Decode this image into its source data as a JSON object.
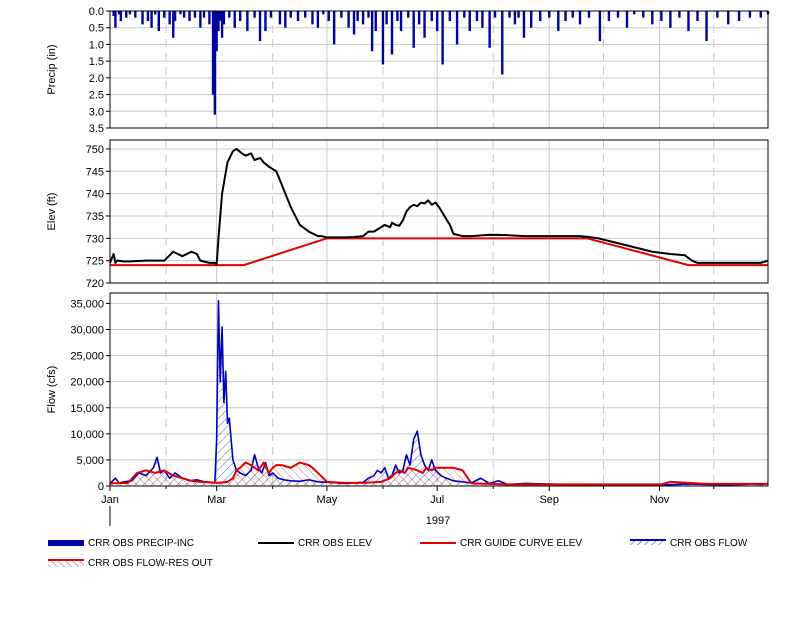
{
  "chart_data": [
    {
      "type": "bar",
      "panel": "precip",
      "ylabel": "Precip (in)",
      "ylim": [
        3.5,
        0.0
      ],
      "inverted": true,
      "yticks": [
        0.0,
        0.5,
        1.0,
        1.5,
        2.0,
        2.5,
        3.0,
        3.5
      ],
      "ytick_labels": [
        "0.0",
        "0.5",
        "1.0",
        "1.5",
        "2.0",
        "2.5",
        "3.0",
        "3.5"
      ],
      "grid": true,
      "series": [
        {
          "name": "CRR OBS PRECIP-INC",
          "color": "#0000a0",
          "x_day": [
            2,
            3,
            5,
            6,
            9,
            11,
            14,
            18,
            21,
            23,
            25,
            27,
            30,
            33,
            35,
            36,
            39,
            41,
            44,
            47,
            50,
            52,
            55,
            57,
            58,
            59,
            60,
            61,
            62,
            63,
            66,
            69,
            72,
            76,
            80,
            83,
            86,
            89,
            94,
            97,
            100,
            104,
            108,
            112,
            115,
            118,
            121,
            124,
            128,
            132,
            135,
            137,
            140,
            143,
            145,
            147,
            151,
            153,
            156,
            159,
            161,
            165,
            168,
            171,
            174,
            178,
            181,
            184,
            188,
            192,
            196,
            199,
            203,
            206,
            210,
            213,
            217,
            221,
            224,
            226,
            229,
            233,
            238,
            243,
            248,
            252,
            256,
            260,
            265,
            271,
            276,
            281,
            286,
            290,
            295,
            300,
            305,
            310,
            315,
            320,
            325,
            330,
            336,
            342,
            348,
            354,
            360,
            364
          ],
          "values": [
            0.15,
            0.5,
            0.1,
            0.3,
            0.2,
            0.1,
            0.2,
            0.4,
            0.3,
            0.5,
            0.1,
            0.6,
            0.2,
            0.4,
            0.8,
            0.3,
            0.1,
            0.2,
            0.3,
            0.2,
            0.5,
            0.2,
            0.4,
            2.5,
            3.1,
            1.2,
            0.6,
            0.3,
            0.8,
            0.4,
            0.2,
            0.5,
            0.3,
            0.6,
            0.2,
            0.9,
            0.6,
            0.2,
            0.4,
            0.5,
            0.2,
            0.3,
            0.2,
            0.4,
            0.5,
            0.1,
            0.3,
            1.0,
            0.2,
            0.5,
            0.7,
            0.3,
            0.4,
            0.2,
            1.2,
            0.6,
            1.6,
            0.4,
            1.3,
            0.3,
            0.6,
            0.2,
            1.1,
            0.4,
            0.8,
            0.3,
            0.6,
            1.6,
            0.3,
            1.0,
            0.2,
            0.6,
            0.3,
            0.5,
            1.1,
            0.2,
            1.9,
            0.2,
            0.4,
            0.2,
            0.8,
            0.5,
            0.3,
            0.2,
            0.6,
            0.3,
            0.2,
            0.4,
            0.2,
            0.9,
            0.3,
            0.2,
            0.5,
            0.1,
            0.2,
            0.4,
            0.3,
            0.5,
            0.2,
            0.6,
            0.3,
            0.9,
            0.2,
            0.4,
            0.3,
            0.2,
            0.2,
            0.1
          ]
        }
      ]
    },
    {
      "type": "line",
      "panel": "elev",
      "ylabel": "Elev (ft)",
      "ylim": [
        720,
        752
      ],
      "yticks": [
        720,
        725,
        730,
        735,
        740,
        745,
        750
      ],
      "ytick_labels": [
        "720",
        "725",
        "730",
        "735",
        "740",
        "745",
        "750"
      ],
      "grid": true,
      "series": [
        {
          "name": "CRR OBS ELEV",
          "color": "#000000",
          "x_day": [
            0,
            2,
            3,
            4,
            8,
            20,
            30,
            35,
            40,
            45,
            48,
            50,
            55,
            58,
            59,
            60,
            62,
            65,
            68,
            70,
            73,
            75,
            78,
            80,
            83,
            85,
            88,
            92,
            96,
            100,
            105,
            110,
            115,
            117,
            120,
            125,
            130,
            135,
            140,
            143,
            146,
            148,
            152,
            155,
            156,
            158,
            160,
            162,
            164,
            166,
            168,
            170,
            172,
            174,
            176,
            178,
            180,
            182,
            185,
            188,
            190,
            195,
            200,
            210,
            220,
            230,
            240,
            250,
            260,
            265,
            270,
            280,
            290,
            300,
            310,
            318,
            322,
            325,
            330,
            340,
            350,
            360,
            364
          ],
          "values": [
            724.5,
            726.5,
            724.5,
            725,
            724.8,
            725,
            725,
            727,
            726,
            727,
            726.5,
            725,
            724.5,
            724.5,
            724.2,
            730,
            740,
            747,
            749.5,
            750,
            749,
            748.5,
            749,
            747.5,
            748,
            747,
            746,
            745,
            741,
            737,
            733,
            731.5,
            730.5,
            730.5,
            730.2,
            730.2,
            730.2,
            730.3,
            730.5,
            731.5,
            731.5,
            732,
            733,
            732.5,
            733.5,
            733,
            732.8,
            734,
            736,
            737,
            737.5,
            737.2,
            738,
            737.8,
            738.5,
            737.5,
            738,
            737,
            735,
            733,
            731,
            730.5,
            730.5,
            730.8,
            730.7,
            730.5,
            730.5,
            730.5,
            730.5,
            730.3,
            730,
            729,
            728,
            727,
            726.5,
            726.2,
            725,
            724.5,
            724.5,
            724.5,
            724.5,
            724.5,
            725
          ]
        },
        {
          "name": "CRR GUIDE CURVE ELEV",
          "color": "#e00000",
          "x_day": [
            0,
            74,
            120,
            264,
            320,
            364
          ],
          "values": [
            724,
            724,
            730,
            730,
            724,
            724
          ]
        }
      ]
    },
    {
      "type": "area",
      "panel": "flow",
      "ylabel": "Flow (cfs)",
      "xlabel": "1997",
      "ylim": [
        0,
        37000
      ],
      "yticks": [
        0,
        5000,
        10000,
        15000,
        20000,
        25000,
        30000,
        35000
      ],
      "ytick_labels": [
        "0",
        "5,000",
        "10,000",
        "15,000",
        "20,000",
        "25,000",
        "30,000",
        "35,000"
      ],
      "x_tick_labels": [
        "Jan",
        "Mar",
        "May",
        "Jul",
        "Sep",
        "Nov"
      ],
      "x_tick_days": [
        0,
        59,
        120,
        181,
        243,
        304
      ],
      "grid": true,
      "series": [
        {
          "name": "CRR OBS FLOW",
          "color": "#0000c0",
          "x_day": [
            0,
            3,
            5,
            8,
            12,
            16,
            20,
            24,
            26,
            28,
            30,
            33,
            36,
            40,
            44,
            48,
            52,
            56,
            58,
            59,
            60,
            61,
            62,
            63,
            64,
            65,
            66,
            67,
            68,
            70,
            72,
            75,
            78,
            80,
            82,
            84,
            86,
            88,
            90,
            93,
            96,
            100,
            105,
            110,
            115,
            120,
            125,
            130,
            135,
            140,
            143,
            146,
            148,
            150,
            152,
            154,
            156,
            158,
            160,
            162,
            164,
            166,
            168,
            170,
            172,
            174,
            176,
            178,
            180,
            183,
            186,
            190,
            195,
            200,
            205,
            210,
            215,
            220,
            230,
            240,
            250,
            260,
            270,
            280,
            290,
            300,
            310,
            320,
            330,
            340,
            350,
            355,
            360,
            364
          ],
          "values": [
            500,
            1500,
            600,
            800,
            1000,
            2500,
            2000,
            3500,
            5500,
            2500,
            3000,
            1500,
            2500,
            1500,
            1000,
            1200,
            800,
            700,
            600,
            9000,
            35500,
            20000,
            30500,
            16000,
            22000,
            12000,
            13000,
            9000,
            5000,
            3000,
            2500,
            2000,
            3000,
            6000,
            3500,
            2500,
            4500,
            2000,
            2500,
            1500,
            1200,
            1000,
            900,
            1200,
            800,
            700,
            600,
            500,
            600,
            700,
            1500,
            2000,
            3000,
            2500,
            3500,
            1500,
            2000,
            4000,
            2500,
            3000,
            6000,
            4000,
            9000,
            10500,
            6000,
            4000,
            3000,
            5000,
            3000,
            2000,
            1500,
            1000,
            800,
            600,
            1500,
            500,
            1000,
            300,
            500,
            400,
            300,
            300,
            250,
            300,
            250,
            300,
            250,
            400,
            300,
            250,
            300,
            400,
            300,
            500
          ]
        },
        {
          "name": "CRR OBS FLOW-RES OUT",
          "color": "#e00000",
          "x_day": [
            0,
            10,
            15,
            20,
            25,
            30,
            35,
            40,
            45,
            50,
            55,
            60,
            65,
            68,
            70,
            72,
            75,
            78,
            82,
            85,
            88,
            90,
            92,
            95,
            100,
            105,
            110,
            112,
            115,
            118,
            120,
            125,
            130,
            140,
            145,
            150,
            155,
            158,
            160,
            163,
            165,
            170,
            173,
            175,
            178,
            180,
            185,
            190,
            195,
            200,
            210,
            220,
            230,
            240,
            250,
            260,
            270,
            280,
            290,
            300,
            305,
            310,
            320,
            330,
            340,
            350,
            360,
            364
          ],
          "values": [
            500,
            600,
            2500,
            3000,
            2500,
            3000,
            2000,
            1500,
            1000,
            800,
            700,
            600,
            800,
            1500,
            3000,
            3500,
            4500,
            4000,
            3000,
            4500,
            2500,
            3500,
            4000,
            4000,
            3500,
            4500,
            4000,
            3500,
            2500,
            1500,
            800,
            700,
            600,
            600,
            700,
            800,
            1500,
            2500,
            3000,
            2500,
            3500,
            3000,
            2500,
            3500,
            3000,
            3500,
            3500,
            3500,
            3000,
            500,
            400,
            300,
            300,
            300,
            300,
            300,
            300,
            300,
            300,
            300,
            300,
            800,
            600,
            400,
            400,
            400,
            400,
            400
          ]
        }
      ]
    }
  ],
  "legend": {
    "items": [
      {
        "label": "CRR OBS PRECIP-INC",
        "style": "thick-bar",
        "color": "#0000a0"
      },
      {
        "label": "CRR OBS ELEV",
        "style": "line",
        "color": "#000000"
      },
      {
        "label": "CRR GUIDE CURVE ELEV",
        "style": "line",
        "color": "#e00000"
      },
      {
        "label": "CRR OBS FLOW",
        "style": "hatch-line",
        "color": "#0000c0"
      },
      {
        "label": "CRR OBS FLOW-RES OUT",
        "style": "hatch-line",
        "color": "#e00000"
      }
    ]
  }
}
